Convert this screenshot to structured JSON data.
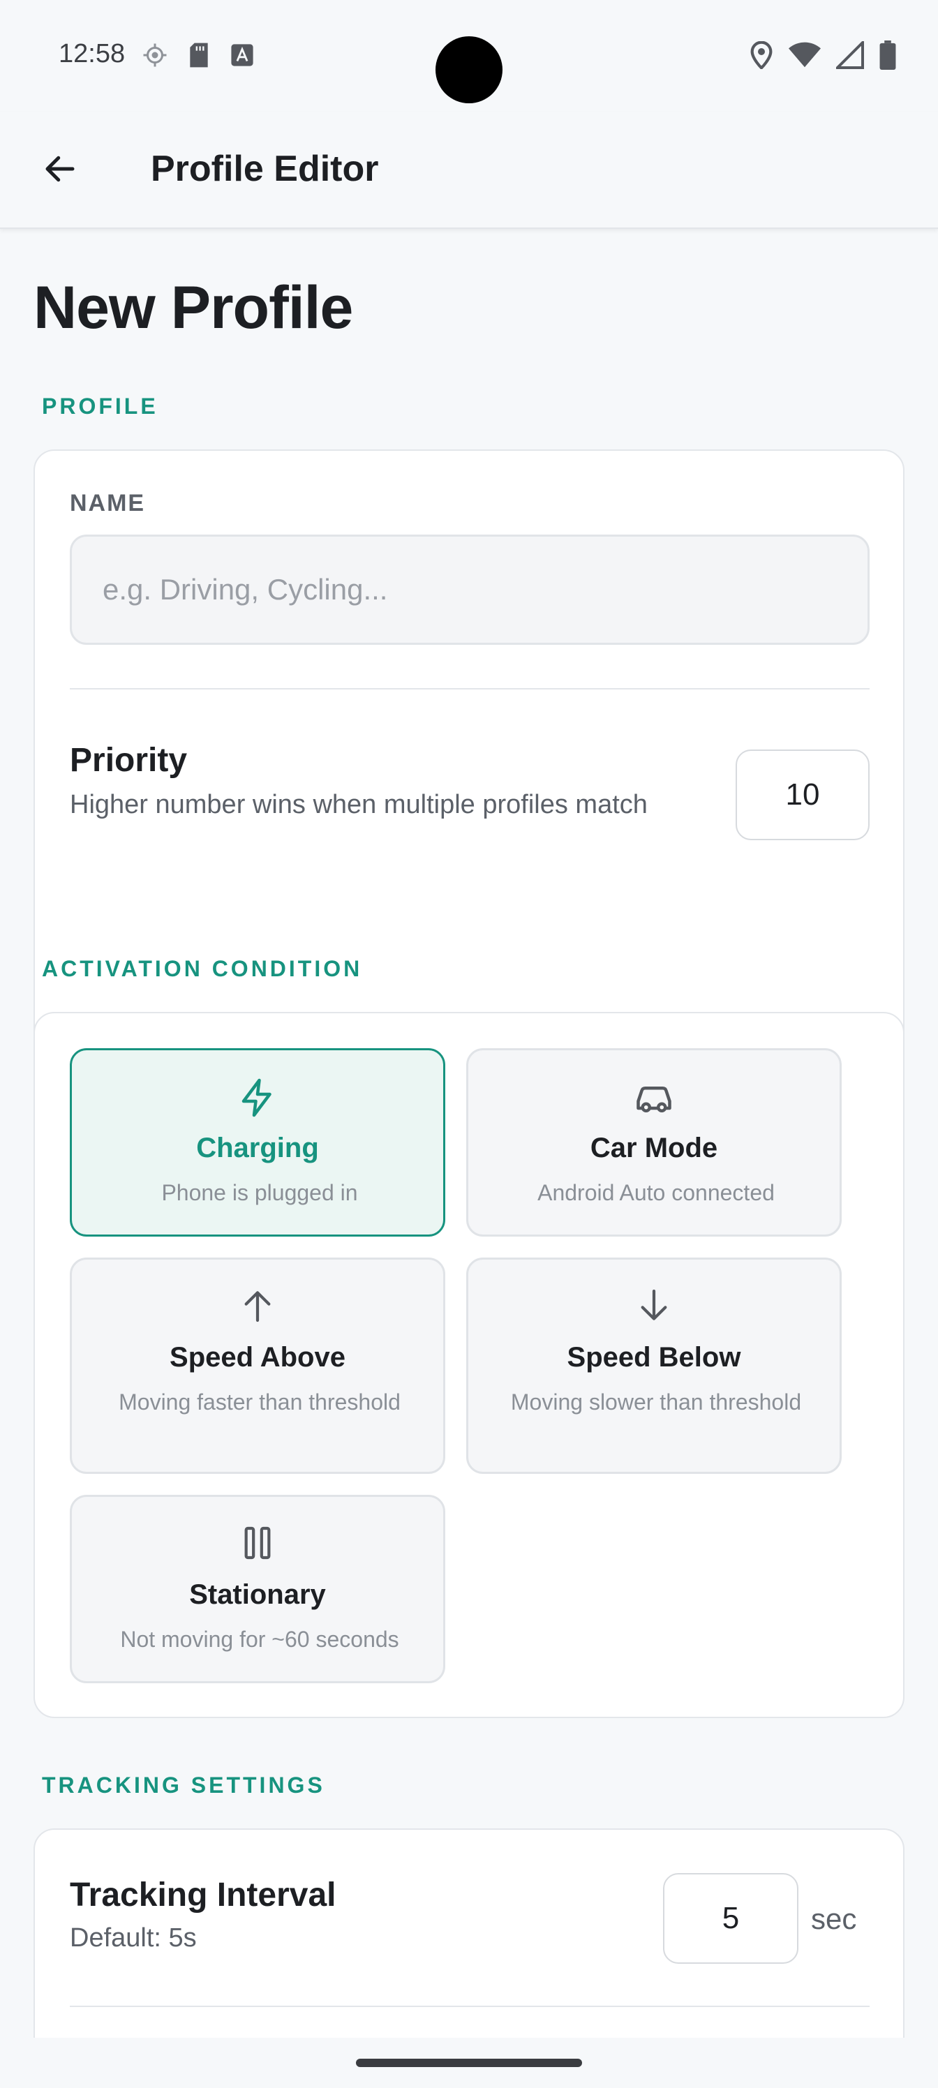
{
  "status_bar": {
    "time": "12:58",
    "left_icons": [
      "location-target-icon",
      "sd-card-icon",
      "keyboard-a-icon"
    ],
    "right_icons": [
      "location-pin-icon",
      "wifi-icon",
      "cell-signal-icon",
      "battery-icon"
    ]
  },
  "app_bar": {
    "back_icon": "arrow-left-icon",
    "title": "Profile Editor"
  },
  "page": {
    "title": "New Profile"
  },
  "profile_section": {
    "label": "PROFILE",
    "name_label": "NAME",
    "name_value": "",
    "name_placeholder": "e.g. Driving, Cycling...",
    "priority_title": "Priority",
    "priority_description": "Higher number wins when multiple profiles match",
    "priority_value": "10"
  },
  "activation_section": {
    "label": "ACTIVATION CONDITION",
    "options": [
      {
        "title": "Charging",
        "description": "Phone is plugged in",
        "icon": "lightning-bolt-icon",
        "selected": true
      },
      {
        "title": "Car Mode",
        "description": "Android Auto connected",
        "icon": "car-icon",
        "selected": false
      },
      {
        "title": "Speed Above",
        "description": "Moving faster than threshold",
        "icon": "arrow-up-icon",
        "selected": false
      },
      {
        "title": "Speed Below",
        "description": "Moving slower than threshold",
        "icon": "arrow-down-icon",
        "selected": false
      },
      {
        "title": "Stationary",
        "description": "Not moving for ~60 seconds",
        "icon": "pause-icon",
        "selected": false
      }
    ]
  },
  "tracking_section": {
    "label": "TRACKING SETTINGS",
    "interval_title": "Tracking Interval",
    "interval_default": "Default: 5s",
    "interval_value": "5",
    "interval_unit": "sec"
  },
  "colors": {
    "accent": "#17937f",
    "selected_bg": "#ebf6f3",
    "background": "#f6f8fa"
  }
}
